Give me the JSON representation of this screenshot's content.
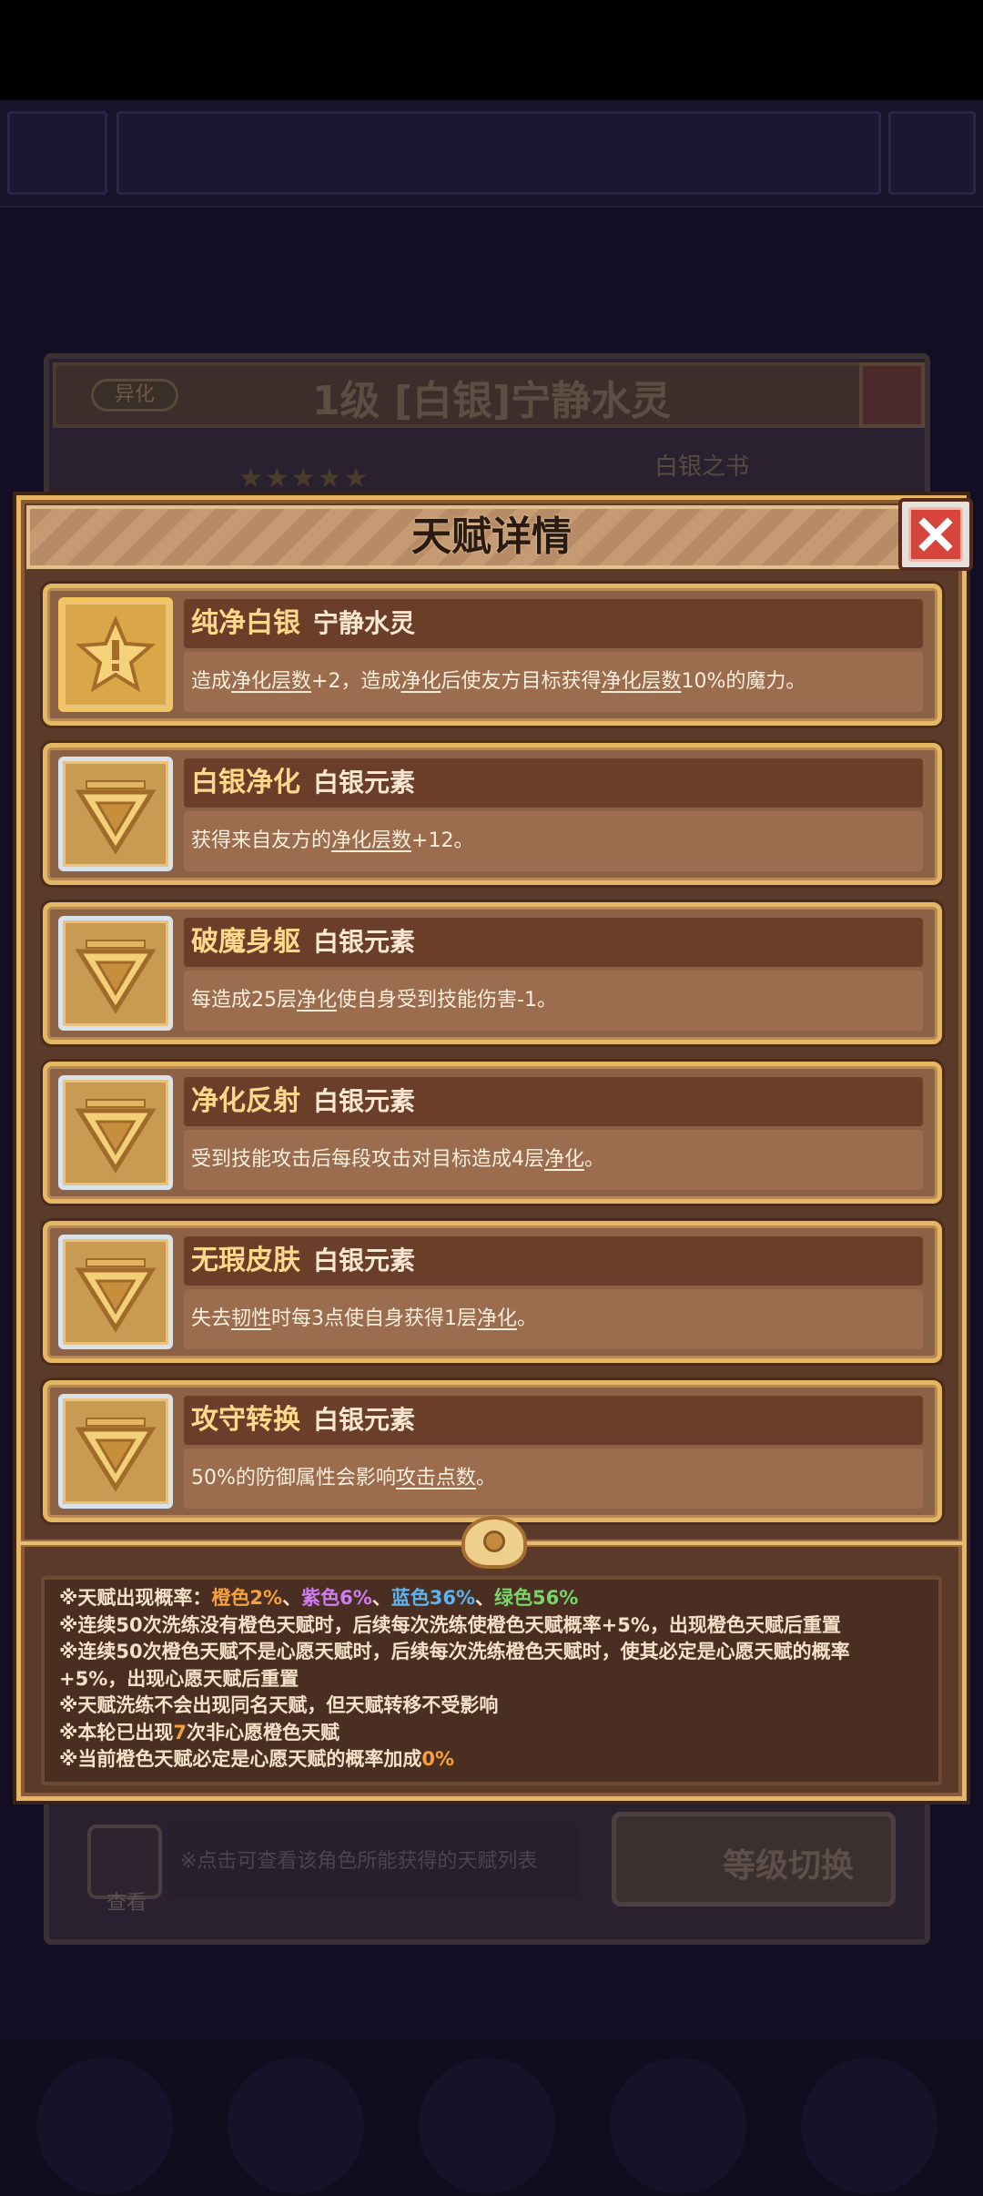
{
  "background": {
    "tag": "异化",
    "title": "1级 [白银]宁静水灵",
    "book_label": "白银之书",
    "view_label": "查看",
    "hint": "※点击可查看该角色所能获得的天赋列表",
    "level_switch": "等级切换"
  },
  "modal": {
    "title": "天赋详情"
  },
  "talents": [
    {
      "name": "纯净白银",
      "element": "宁静水灵",
      "frame": "gold",
      "icon": "star-icon",
      "desc_parts": [
        "造成",
        "净化层数",
        "+2，造成",
        "净化",
        "后使友方目标获得",
        "净化层数",
        "10%的魔力。"
      ]
    },
    {
      "name": "白银净化",
      "element": "白银元素",
      "frame": "silver",
      "icon": "triangle-emblem-icon",
      "desc_parts": [
        "获得来自友方的",
        "净化层数",
        "+12。"
      ]
    },
    {
      "name": "破魔身躯",
      "element": "白银元素",
      "frame": "silver",
      "icon": "triangle-emblem-icon",
      "desc_parts": [
        "每造成25层",
        "净化",
        "使自身受到技能伤害-1。"
      ]
    },
    {
      "name": "净化反射",
      "element": "白银元素",
      "frame": "silver",
      "icon": "triangle-emblem-icon",
      "desc_parts": [
        "受到技能攻击后每段攻击对目标造成4层",
        "净化",
        "。"
      ]
    },
    {
      "name": "无瑕皮肤",
      "element": "白银元素",
      "frame": "silver",
      "icon": "triangle-emblem-icon",
      "desc_parts": [
        "失去",
        "韧性",
        "时每3点使自身获得1层",
        "净化",
        "。"
      ]
    },
    {
      "name": "攻守转换",
      "element": "白银元素",
      "frame": "silver",
      "icon": "triangle-emblem-icon",
      "desc_parts": [
        "50%的防御属性会影响",
        "攻击点数",
        "。"
      ]
    }
  ],
  "info": {
    "line1_prefix": "※天赋出现概率：",
    "orange_rate": "橙色2%",
    "sep": "、",
    "purple_rate": "紫色6%",
    "blue_rate": "蓝色36%",
    "green_rate": "绿色56%",
    "line2": "※连续50次洗练没有橙色天赋时，后续每次洗练使橙色天赋概率+5%，出现橙色天赋后重置",
    "line3": "※连续50次橙色天赋不是心愿天赋时，后续每次洗练橙色天赋时，使其必定是心愿天赋的概率",
    "line4": "+5%，出现心愿天赋后重置",
    "line5": "※天赋洗练不会出现同名天赋，但天赋转移不受影响",
    "line6_prefix": "※本轮已出现",
    "line6_count": "7",
    "line6_suffix": "次非心愿橙色天赋",
    "line7_prefix": "※当前橙色天赋必定是心愿天赋的概率加成",
    "line7_value": "0%"
  },
  "colors": {
    "orange": "#f6a13a",
    "purple": "#cf7cf2",
    "blue": "#5db4f0",
    "green": "#78d56a",
    "close_red": "#d7443c"
  }
}
